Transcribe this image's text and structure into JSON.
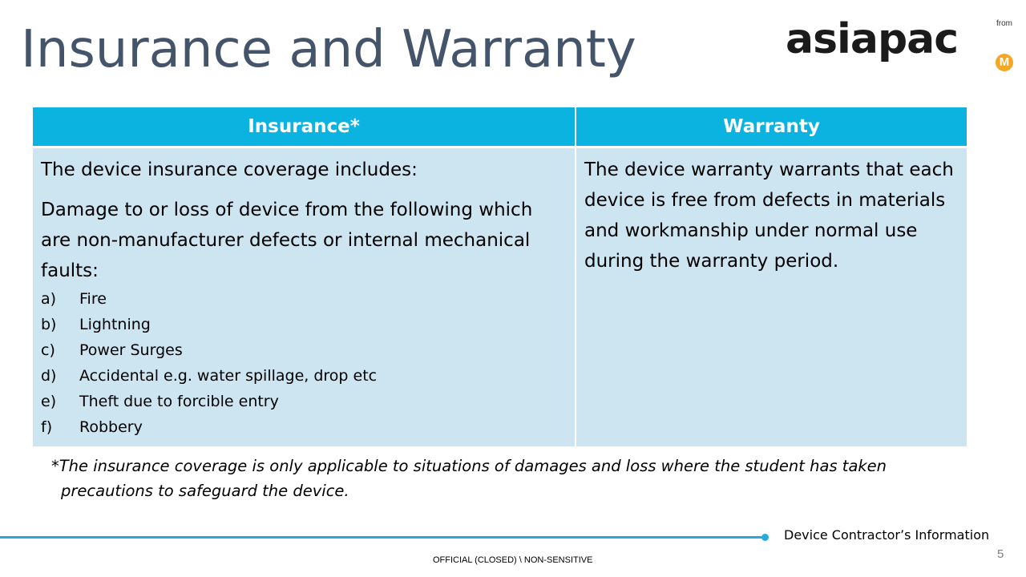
{
  "slide": {
    "title": "Insurance and Warranty",
    "logo": {
      "wordmark": "asiapac",
      "from_label": "from",
      "badge_letter": "M",
      "badge_color": "#f5a623"
    },
    "table": {
      "header_color": "#0ab3e0",
      "cell_color": "#cde4f1",
      "headers": [
        "Insurance*",
        "Warranty"
      ],
      "insurance": {
        "intro": "The device insurance coverage includes:",
        "description": "Damage to or loss of device from the following which are non-manufacturer defects or internal mechanical faults:",
        "items": [
          {
            "marker": "a)",
            "text": "Fire"
          },
          {
            "marker": "b)",
            "text": "Lightning"
          },
          {
            "marker": "c)",
            "text": "Power Surges"
          },
          {
            "marker": "d)",
            "text": "Accidental e.g. water spillage, drop etc"
          },
          {
            "marker": "e)",
            "text": "Theft due to forcible entry"
          },
          {
            "marker": "f)",
            "text": "Robbery"
          }
        ]
      },
      "warranty": {
        "text": "The device warranty warrants that each device is free from defects in materials and workmanship under normal use during the warranty period."
      }
    },
    "footnote": {
      "line1": "*The insurance coverage is only applicable to situations of damages and loss where the student has taken",
      "line2": "precautions to safeguard the device."
    },
    "footer": {
      "section": "Device Contractor’s Information",
      "page_number": "5",
      "classification": "OFFICIAL (CLOSED) \\ NON-SENSITIVE",
      "accent_color": "#29a8dc"
    }
  }
}
